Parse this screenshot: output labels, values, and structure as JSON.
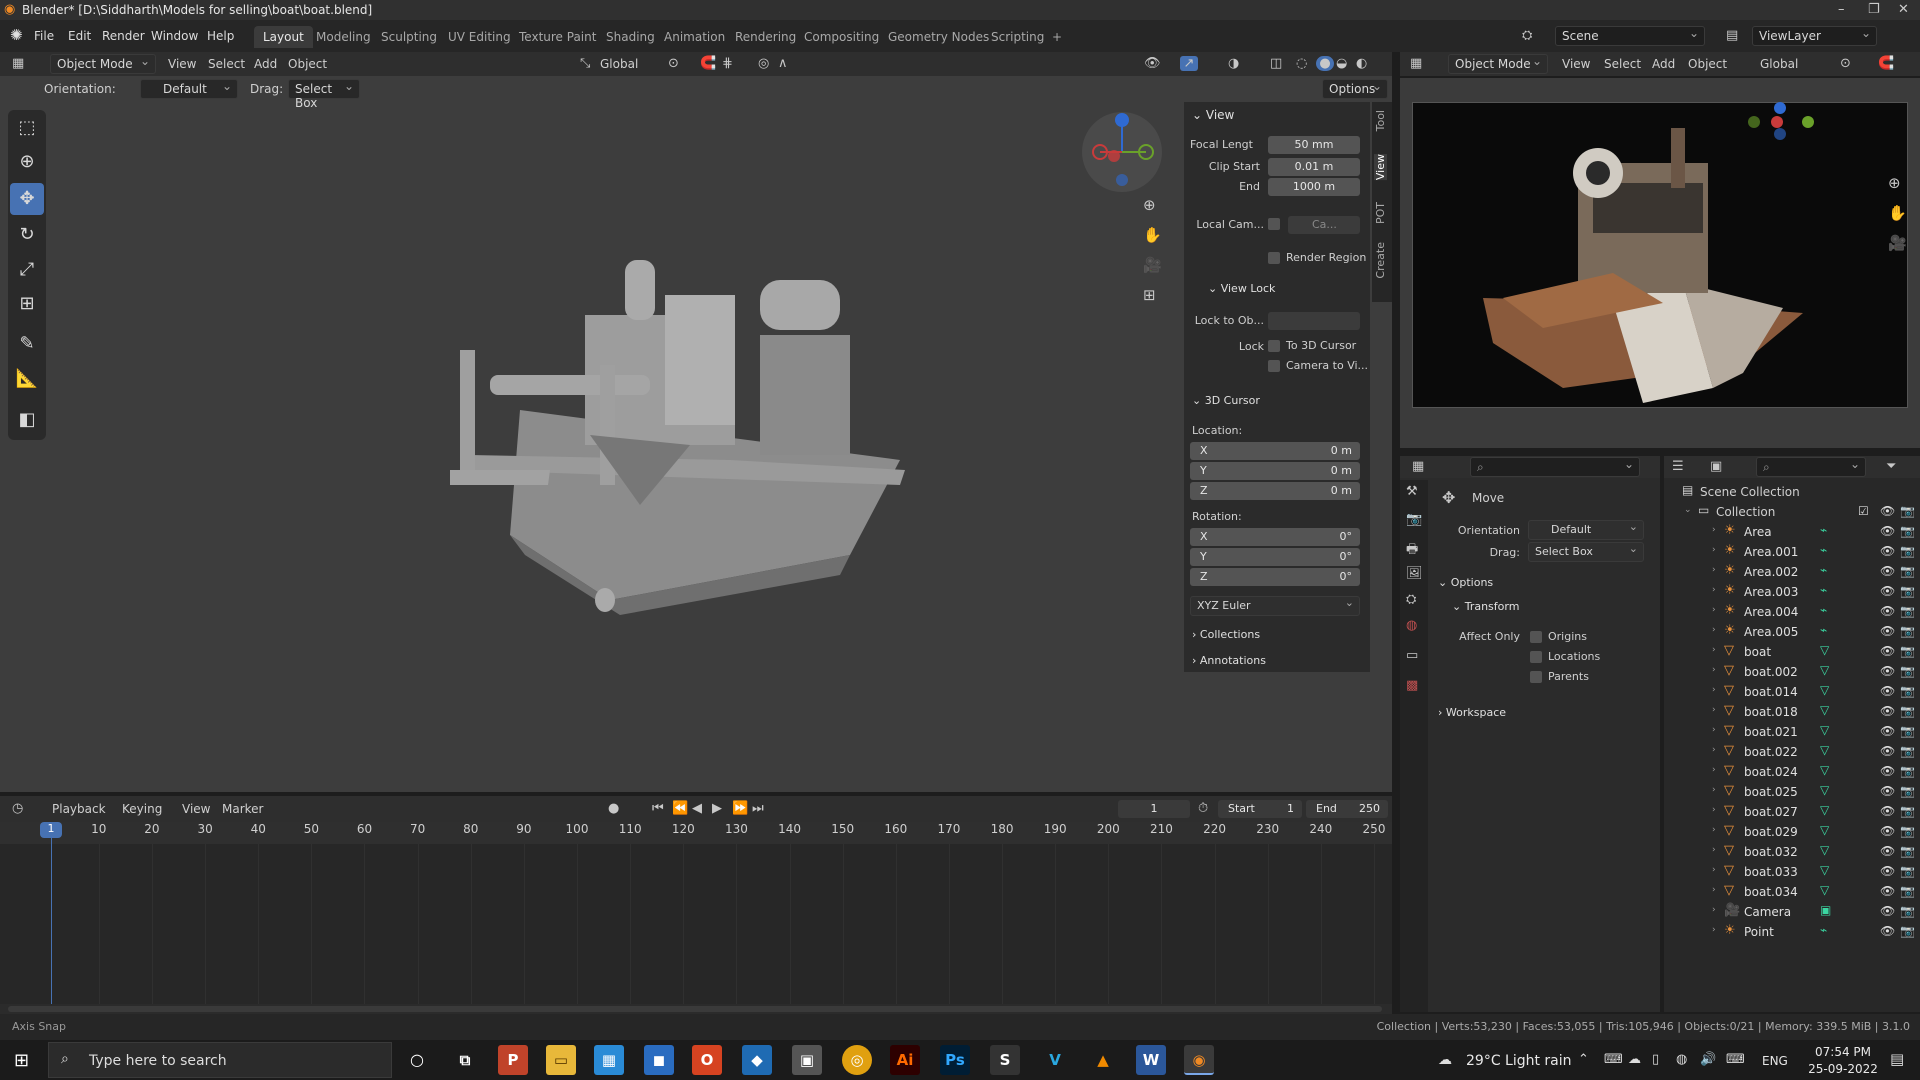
{
  "window": {
    "title": "Blender* [D:\\Siddharth\\Models for selling\\boat\\boat.blend]",
    "min": "–",
    "max": "❐",
    "close": "✕"
  },
  "menu": [
    "File",
    "Edit",
    "Render",
    "Window",
    "Help"
  ],
  "workspaces": [
    "Layout",
    "Modeling",
    "Sculpting",
    "UV Editing",
    "Texture Paint",
    "Shading",
    "Animation",
    "Rendering",
    "Compositing",
    "Geometry Nodes",
    "Scripting",
    "+"
  ],
  "scene": {
    "label": "Scene",
    "viewlayer": "ViewLayer"
  },
  "viewport_header": {
    "mode": "Object Mode",
    "menus": [
      "View",
      "Select",
      "Add",
      "Object"
    ],
    "transform": "Global"
  },
  "tool_settings": {
    "orientation_label": "Orientation:",
    "orientation_value": "Default",
    "drag_label": "Drag:",
    "drag_value": "Select Box",
    "options": "Options"
  },
  "npanel": {
    "tabs": [
      "Tool",
      "View",
      "POT",
      "Create"
    ],
    "view_header": "View",
    "focal_label": "Focal Lengt",
    "focal": "50 mm",
    "clipstart_label": "Clip Start",
    "clipstart": "0.01 m",
    "end_label": "End",
    "end": "1000 m",
    "localcam_label": "Local Cam...",
    "localcam": "Ca...",
    "render_region": "Render Region",
    "viewlock_header": "View Lock",
    "lockto_label": "Lock to Ob...",
    "lock_label": "Lock",
    "to3d": "To 3D Cursor",
    "camtovi": "Camera to Vi...",
    "cursor_header": "3D Cursor",
    "location_label": "Location:",
    "loc_x": "0 m",
    "loc_y": "0 m",
    "loc_z": "0 m",
    "rotation_label": "Rotation:",
    "rot_x": "0°",
    "rot_y": "0°",
    "rot_z": "0°",
    "axes": [
      "X",
      "Y",
      "Z"
    ],
    "euler": "XYZ Euler",
    "collections": "Collections",
    "annotations": "Annotations"
  },
  "render_view_header": {
    "mode": "Object Mode",
    "menus": [
      "View",
      "Select",
      "Add",
      "Object"
    ],
    "transform": "Global"
  },
  "properties": {
    "tool_name": "Move",
    "orientation_label": "Orientation",
    "orientation": "Default",
    "drag_label": "Drag:",
    "drag": "Select Box",
    "options": "Options",
    "transform": "Transform",
    "affect_label": "Affect Only",
    "origins": "Origins",
    "locations": "Locations",
    "parents": "Parents",
    "workspace": "Workspace"
  },
  "outliner": {
    "scene_collection": "Scene Collection",
    "collection": "Collection",
    "items": [
      {
        "name": "Area",
        "type": "light"
      },
      {
        "name": "Area.001",
        "type": "light"
      },
      {
        "name": "Area.002",
        "type": "light"
      },
      {
        "name": "Area.003",
        "type": "light"
      },
      {
        "name": "Area.004",
        "type": "light"
      },
      {
        "name": "Area.005",
        "type": "light"
      },
      {
        "name": "boat",
        "type": "mesh"
      },
      {
        "name": "boat.002",
        "type": "mesh"
      },
      {
        "name": "boat.014",
        "type": "mesh"
      },
      {
        "name": "boat.018",
        "type": "mesh"
      },
      {
        "name": "boat.021",
        "type": "mesh"
      },
      {
        "name": "boat.022",
        "type": "mesh"
      },
      {
        "name": "boat.024",
        "type": "mesh"
      },
      {
        "name": "boat.025",
        "type": "mesh"
      },
      {
        "name": "boat.027",
        "type": "mesh"
      },
      {
        "name": "boat.029",
        "type": "mesh"
      },
      {
        "name": "boat.032",
        "type": "mesh"
      },
      {
        "name": "boat.033",
        "type": "mesh"
      },
      {
        "name": "boat.034",
        "type": "mesh"
      },
      {
        "name": "Camera",
        "type": "camera"
      },
      {
        "name": "Point",
        "type": "light"
      }
    ]
  },
  "timeline": {
    "menus": [
      "Playback",
      "Keying",
      "View",
      "Marker"
    ],
    "current": "1",
    "start_label": "Start",
    "start": "1",
    "end_label": "End",
    "end": "250",
    "ticks": [
      "10",
      "20",
      "30",
      "40",
      "50",
      "60",
      "70",
      "80",
      "90",
      "100",
      "110",
      "120",
      "130",
      "140",
      "150",
      "160",
      "170",
      "180",
      "190",
      "200",
      "210",
      "220",
      "230",
      "240",
      "250"
    ],
    "frame_marker": "1"
  },
  "statusbar": {
    "left": "Axis Snap",
    "right": "Collection | Verts:53,230 | Faces:53,055 | Tris:105,946 | Objects:0/21 | Memory: 339.5 MiB | 3.1.0"
  },
  "taskbar": {
    "search": "Type here to search",
    "weather": "29°C  Light rain",
    "lang": "ENG",
    "time": "07:54 PM",
    "date": "25-09-2022"
  },
  "colors": {
    "accent": "#4772b3",
    "active_frame": "#4772b3",
    "mesh_icon": "#e8913c",
    "data_icon": "#3bd6a2"
  }
}
